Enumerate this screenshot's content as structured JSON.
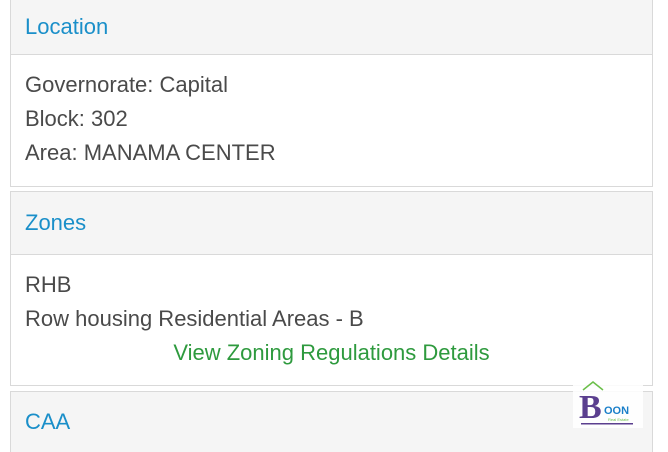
{
  "location": {
    "heading": "Location",
    "governorate": "Governorate: Capital",
    "block": "Block: 302",
    "area": "Area: MANAMA CENTER"
  },
  "zones": {
    "heading": "Zones",
    "code": "RHB",
    "description": "Row housing Residential Areas - B",
    "link_label": "View Zoning Regulations Details"
  },
  "caa": {
    "heading": "CAA"
  },
  "logo": {
    "letter": "B",
    "text": "OON",
    "tagline": "Real Estate"
  },
  "colors": {
    "heading_blue": "#1a8fc9",
    "link_green": "#2e9a3e",
    "logo_purple": "#5b3f8f",
    "logo_blue": "#1a7fc9",
    "logo_green": "#6bbf4a"
  }
}
